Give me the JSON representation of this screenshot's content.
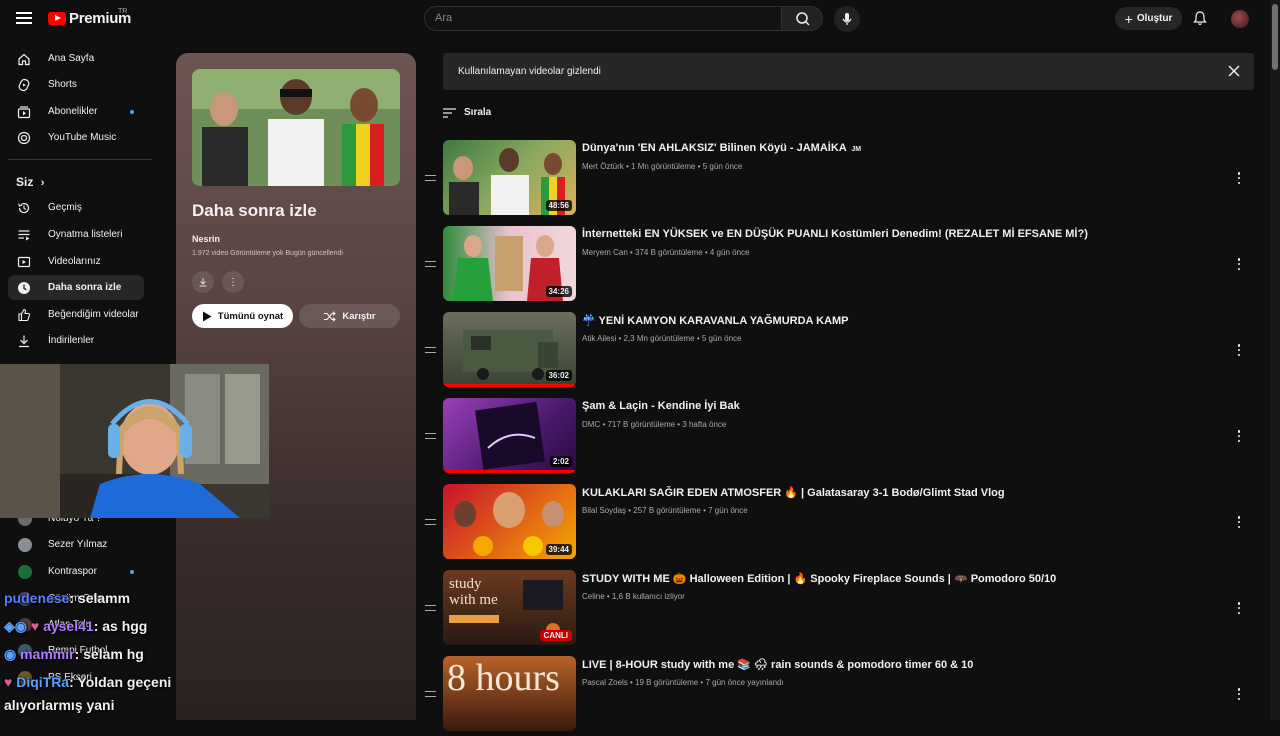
{
  "header": {
    "logo_text": "Premium",
    "logo_region": "TR",
    "search_placeholder": "Ara",
    "create_label": "Oluştur",
    "icons": [
      "menu-icon",
      "search-icon",
      "mic-icon",
      "plus-icon",
      "bell-icon"
    ]
  },
  "sidebar": {
    "main": [
      {
        "label": "Ana Sayfa",
        "icon": "home-icon"
      },
      {
        "label": "Shorts",
        "icon": "shorts-icon"
      },
      {
        "label": "Abonelikler",
        "icon": "subscriptions-icon",
        "dot": true
      },
      {
        "label": "YouTube Music",
        "icon": "music-icon"
      }
    ],
    "you_heading": "Siz",
    "you": [
      {
        "label": "Geçmiş",
        "icon": "history-icon"
      },
      {
        "label": "Oynatma listeleri",
        "icon": "playlists-icon"
      },
      {
        "label": "Videolarınız",
        "icon": "your-videos-icon"
      },
      {
        "label": "Daha sonra izle",
        "icon": "watch-later-icon",
        "active": true
      },
      {
        "label": "Beğendiğim videolar",
        "icon": "like-icon"
      },
      {
        "label": "İndirilenler",
        "icon": "download-icon"
      }
    ],
    "subs": [
      {
        "label": "Noluyo Ya ?"
      },
      {
        "label": "Sezer Yılmaz"
      },
      {
        "label": "Kontraspor",
        "dot": true
      },
      {
        "label": "Çözüm Orta..."
      },
      {
        "label": "Atlas Tolu"
      },
      {
        "label": "Rempi Futbol"
      },
      {
        "label": "PS Ekseri"
      }
    ]
  },
  "playlist": {
    "title": "Daha sonra izle",
    "owner": "Nesrin",
    "meta": "1.972 video  Görüntüleme yok  Bugün güncellendi",
    "play_all": "Tümünü oynat",
    "shuffle": "Karıştır"
  },
  "notice": {
    "text": "Kullanılamayan videolar gizlendi"
  },
  "sort_label": "Sırala",
  "videos": [
    {
      "title": "Dünya'nın 'EN AHLAKSIZ' Bilinen Köyü - JAMAİKA",
      "title_suffix": "JM",
      "meta": "Mert Öztürk • 1 Mn görüntüleme • 5 gün önce",
      "duration": "48:56",
      "colors": "#3e7a3f,#d9b25a"
    },
    {
      "title": "İnternetteki EN YÜKSEK ve EN DÜŞÜK PUANLI Kostümleri Denedim! (REZALET Mİ EFSANE Mİ?)",
      "meta": "Meryem Can • 374 B görüntüleme • 4 gün önce",
      "duration": "34:26",
      "colors": "#e9c3cf,#2f8a3b"
    },
    {
      "title": "☔ YENİ KAMYON KARAVANLA YAĞMURDA KAMP",
      "meta": "Atik Ailesi • 2,3 Mn görüntüleme • 5 gün önce",
      "duration": "36:02",
      "colors": "#4d5a45,#2c3328"
    },
    {
      "title": "Şam & Laçin - Kendine İyi Bak",
      "meta": "DMC • 717 B görüntüleme • 3 hafta önce",
      "duration": "2:02",
      "colors": "#4a1a6e,#9b3fb8"
    },
    {
      "title": "KULAKLARI SAĞIR EDEN ATMOSFER 🔥 | Galatasaray 3-1 Bodø/Glimt Stad Vlog",
      "meta": "Bilal Soydaş • 257 B görüntüleme • 7 gün önce",
      "duration": "39:44",
      "colors": "#c8102e,#f6a800"
    },
    {
      "title": "STUDY WITH ME 🎃 Halloween Edition | 🔥 Spooky Fireplace Sounds | 🦇 Pomodoro 50/10",
      "meta": "Celine • 1,6 B kullanıcı izliyor",
      "duration": "CANLI",
      "live": true,
      "colors": "#6b3a20,#2a1a12"
    },
    {
      "title": "LIVE | 8-HOUR study with me 📚 🌧 rain sounds & pomodoro timer 60 & 10",
      "meta": "Pascal Zoels • 19 B görüntüleme • 7 gün önce yayınlandı",
      "duration": "",
      "colors": "#b8622a,#3a1a0c",
      "thumb_text": "8 hours"
    }
  ],
  "chat": [
    {
      "user": "pudenese",
      "msg": ": selamm"
    },
    {
      "user": "aysel41",
      "msg": ": as hgg"
    },
    {
      "user": "mammir",
      "msg": ": selam hg"
    },
    {
      "user": "DiqiTRa",
      "msg": ": Yoldan geçeni"
    },
    {
      "user": "",
      "msg": "alıyorlarmış yani"
    }
  ]
}
